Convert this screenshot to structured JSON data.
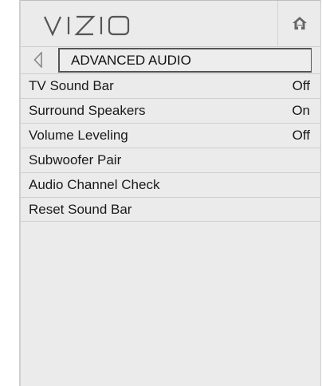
{
  "header": {
    "brand": "VIZIO",
    "home_icon": "home-icon"
  },
  "breadcrumb": {
    "back_icon": "back-arrow-icon",
    "title": "ADVANCED AUDIO"
  },
  "menu": {
    "items": [
      {
        "label": "TV Sound Bar",
        "value": "Off"
      },
      {
        "label": "Surround Speakers",
        "value": "On"
      },
      {
        "label": "Volume Leveling",
        "value": "Off"
      },
      {
        "label": "Subwoofer Pair",
        "value": ""
      },
      {
        "label": "Audio Channel Check",
        "value": ""
      },
      {
        "label": "Reset Sound Bar",
        "value": ""
      }
    ]
  },
  "colors": {
    "panel_bg": "#ebebeb",
    "text": "#1a1a1a",
    "divider": "#cfcfcf"
  }
}
